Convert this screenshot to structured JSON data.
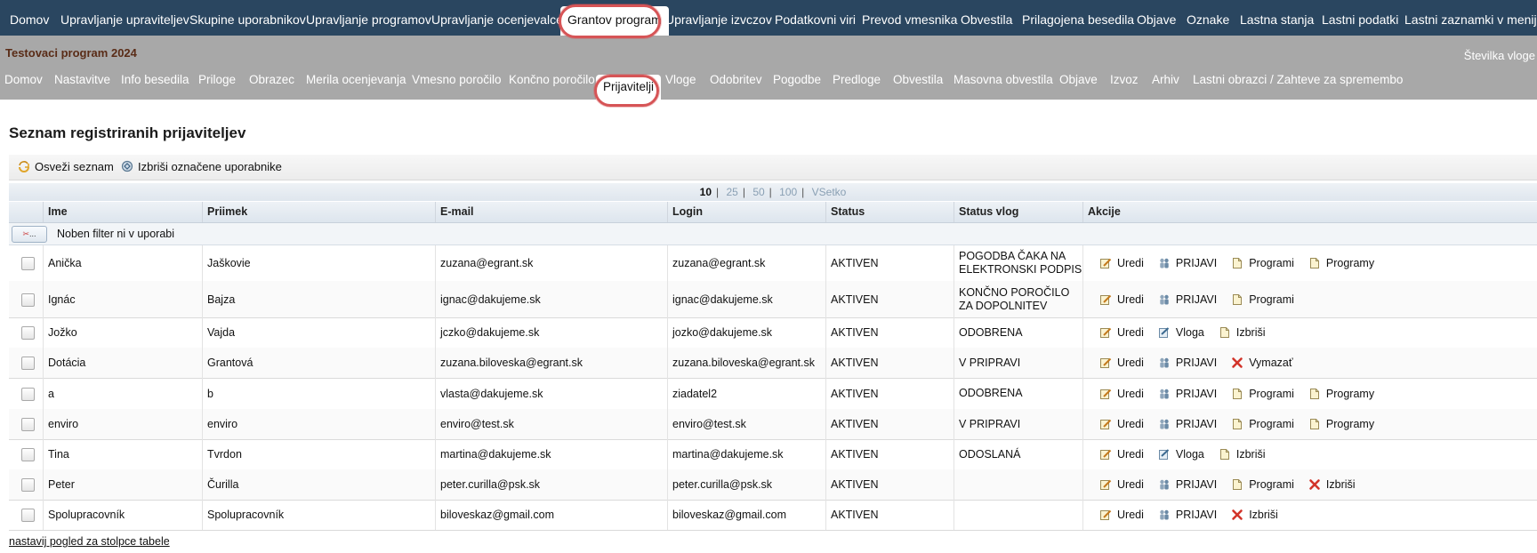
{
  "top_nav": [
    {
      "label": "Domov",
      "active": false
    },
    {
      "label": "Upravljanje upraviteljev",
      "active": false
    },
    {
      "label": "Skupine uporabnikov",
      "active": false
    },
    {
      "label": "Upravljanje programov",
      "active": false
    },
    {
      "label": "Upravljanje ocenjevalcev",
      "active": false
    },
    {
      "label": "Grantov program",
      "active": true
    },
    {
      "label": "Upravljanje izvczov",
      "active": false
    },
    {
      "label": "Podatkovni viri",
      "active": false
    },
    {
      "label": "Prevod vmesnika",
      "active": false
    },
    {
      "label": "Obvestila",
      "active": false
    },
    {
      "label": "Prilagojena besedila",
      "active": false
    },
    {
      "label": "Objave",
      "active": false
    },
    {
      "label": "Oznake",
      "active": false
    },
    {
      "label": "Lastna stanja",
      "active": false
    },
    {
      "label": "Lastni podatki",
      "active": false
    },
    {
      "label": "Lastni zaznamki v meniju",
      "active": false
    }
  ],
  "program_title": "Testovaci program 2024",
  "vloga_number_label": "Številka vloge",
  "sub_tabs": [
    {
      "label": "Domov",
      "active": false
    },
    {
      "label": "Nastavitve",
      "active": false
    },
    {
      "label": "Info besedila",
      "active": false
    },
    {
      "label": "Priloge",
      "active": false
    },
    {
      "label": "Obrazec",
      "active": false
    },
    {
      "label": "Merila ocenjevanja",
      "active": false
    },
    {
      "label": "Vmesno poročilo",
      "active": false
    },
    {
      "label": "Končno poročilo",
      "active": false
    },
    {
      "label": "Prijavitelji",
      "active": true
    },
    {
      "label": "Vloge",
      "active": false
    },
    {
      "label": "Odobritev",
      "active": false
    },
    {
      "label": "Pogodbe",
      "active": false
    },
    {
      "label": "Predloge",
      "active": false
    },
    {
      "label": "Obvestila",
      "active": false
    },
    {
      "label": "Masovna obvestila",
      "active": false
    },
    {
      "label": "Objave",
      "active": false
    },
    {
      "label": "Izvoz",
      "active": false
    },
    {
      "label": "Arhiv",
      "active": false
    },
    {
      "label": "Lastni obrazci / Zahteve za spremembo",
      "active": false
    }
  ],
  "page_title": "Seznam registriranih prijaviteljev",
  "toolbar": {
    "refresh_label": "Osveži seznam",
    "delete_label": "Izbriši označene uporabnike"
  },
  "pager": {
    "options": [
      "10",
      "25",
      "50",
      "100",
      "VSetko"
    ],
    "selected": "10"
  },
  "columns": [
    "Ime",
    "Priimek",
    "E-mail",
    "Login",
    "Status",
    "Status vlog",
    "Akcije"
  ],
  "filter_button_label": "...",
  "filter_text": "Noben filter ni v uporabi",
  "rows": [
    {
      "ime": "Anička",
      "priimek": "Jaškovie",
      "email": "zuzana@egrant.sk",
      "login": "zuzana@egrant.sk",
      "status": "AKTIVEN",
      "status_vlog": "POGODBA ČAKA NA ELEKTRONSKI PODPIS",
      "actions": [
        {
          "label": "Uredi",
          "icon": "edit-icon"
        },
        {
          "label": "PRIJAVI",
          "icon": "users-icon"
        },
        {
          "label": "Programi",
          "icon": "document-icon"
        },
        {
          "label": "Programy",
          "icon": "document-icon"
        }
      ]
    },
    {
      "ime": "Ignác",
      "priimek": "Bajza",
      "email": "ignac@dakujeme.sk",
      "login": "ignac@dakujeme.sk",
      "status": "AKTIVEN",
      "status_vlog": "KONČNO POROČILO ZA DOPOLNITEV",
      "actions": [
        {
          "label": "Uredi",
          "icon": "edit-icon"
        },
        {
          "label": "PRIJAVI",
          "icon": "users-icon"
        },
        {
          "label": "Programi",
          "icon": "document-icon"
        }
      ]
    },
    {
      "ime": "Jožko",
      "priimek": "Vajda",
      "email": "jczko@dakujeme.sk",
      "login": "jozko@dakujeme.sk",
      "status": "AKTIVEN",
      "status_vlog": "ODOBRENA",
      "actions": [
        {
          "label": "Uredi",
          "icon": "edit-icon"
        },
        {
          "label": "Vloga",
          "icon": "vloga-icon"
        },
        {
          "label": "Izbriši",
          "icon": "document-icon"
        }
      ]
    },
    {
      "ime": "Dotácia",
      "priimek": "Grantová",
      "email": "zuzana.biloveska@egrant.sk",
      "login": "zuzana.biloveska@egrant.sk",
      "status": "AKTIVEN",
      "status_vlog": "V PRIPRAVI",
      "actions": [
        {
          "label": "Uredi",
          "icon": "edit-icon"
        },
        {
          "label": "PRIJAVI",
          "icon": "users-icon"
        },
        {
          "label": "Vymazať",
          "icon": "delete-icon"
        }
      ]
    },
    {
      "ime": "a",
      "priimek": "b",
      "email": "vlasta@dakujeme.sk",
      "login": "ziadatel2",
      "status": "AKTIVEN",
      "status_vlog": "ODOBRENA",
      "actions": [
        {
          "label": "Uredi",
          "icon": "edit-icon"
        },
        {
          "label": "PRIJAVI",
          "icon": "users-icon"
        },
        {
          "label": "Programi",
          "icon": "document-icon"
        },
        {
          "label": "Programy",
          "icon": "document-icon"
        }
      ]
    },
    {
      "ime": "enviro",
      "priimek": "enviro",
      "email": "enviro@test.sk",
      "login": "enviro@test.sk",
      "status": "AKTIVEN",
      "status_vlog": "V PRIPRAVI",
      "actions": [
        {
          "label": "Uredi",
          "icon": "edit-icon"
        },
        {
          "label": "PRIJAVI",
          "icon": "users-icon"
        },
        {
          "label": "Programi",
          "icon": "document-icon"
        },
        {
          "label": "Programy",
          "icon": "document-icon"
        }
      ]
    },
    {
      "ime": "Tina",
      "priimek": "Tvrdon",
      "email": "martina@dakujeme.sk",
      "login": "martina@dakujeme.sk",
      "status": "AKTIVEN",
      "status_vlog": "ODOSLANÁ",
      "actions": [
        {
          "label": "Uredi",
          "icon": "edit-icon"
        },
        {
          "label": "Vloga",
          "icon": "vloga-icon"
        },
        {
          "label": "Izbriši",
          "icon": "document-icon"
        }
      ]
    },
    {
      "ime": "Peter",
      "priimek": "Čurilla",
      "email": "peter.curilla@psk.sk",
      "login": "peter.curilla@psk.sk",
      "status": "AKTIVEN",
      "status_vlog": "",
      "actions": [
        {
          "label": "Uredi",
          "icon": "edit-icon"
        },
        {
          "label": "PRIJAVI",
          "icon": "users-icon"
        },
        {
          "label": "Programi",
          "icon": "document-icon"
        },
        {
          "label": "Izbriši",
          "icon": "delete-icon"
        }
      ]
    },
    {
      "ime": "Spolupracovník",
      "priimek": "Spolupracovník",
      "email": "biloveskaz@gmail.com",
      "login": "biloveskaz@gmail.com",
      "status": "AKTIVEN",
      "status_vlog": "",
      "actions": [
        {
          "label": "Uredi",
          "icon": "edit-icon"
        },
        {
          "label": "PRIJAVI",
          "icon": "users-icon"
        },
        {
          "label": "Izbriši",
          "icon": "delete-icon"
        }
      ]
    }
  ],
  "footer_link": "nastavij pogled za stolpce tabele",
  "colors": {
    "top_nav_bg": "#2a4660",
    "sub_bar_bg": "#a8a8a8",
    "highlight": "#d65456",
    "program_title": "#5a2c17"
  }
}
